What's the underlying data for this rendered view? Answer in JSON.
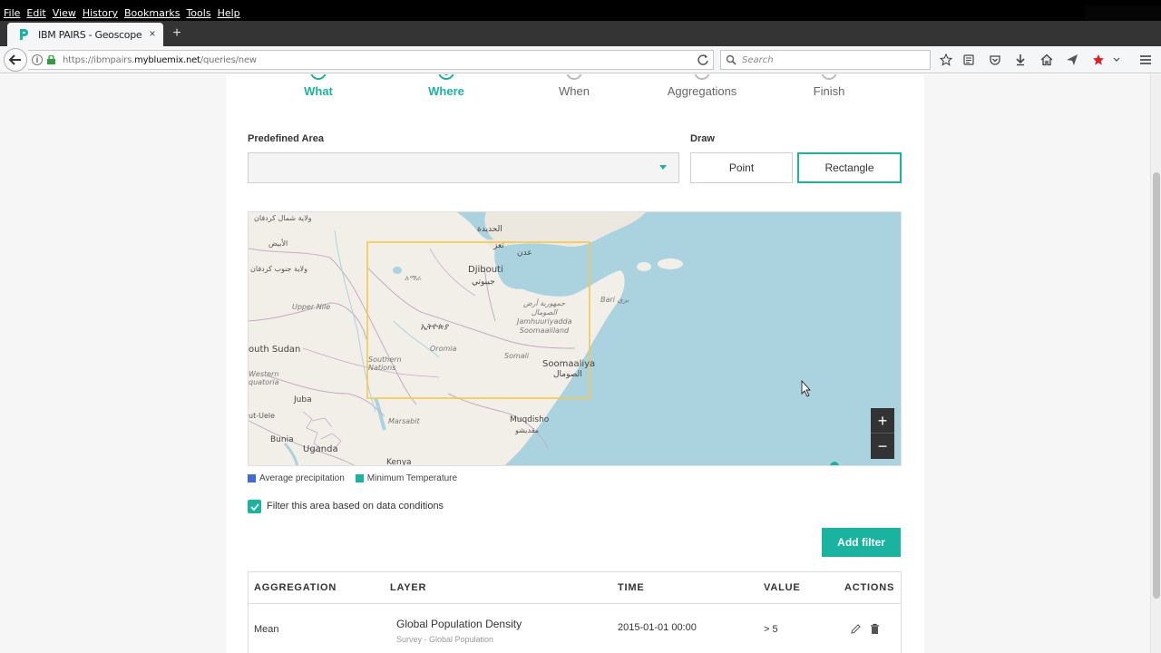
{
  "browser": {
    "menu": [
      "File",
      "Edit",
      "View",
      "History",
      "Bookmarks",
      "Tools",
      "Help"
    ],
    "tab_title": "IBM PAIRS - Geoscope - N...",
    "url_prefix": "https://ibmpairs.",
    "url_domain": "mybluemix.net",
    "url_path": "/queries/new",
    "search_placeholder": "Search",
    "accent_color": "#1ab39f"
  },
  "steps": [
    {
      "label": "What",
      "state": "done"
    },
    {
      "label": "Where",
      "state": "current"
    },
    {
      "label": "When",
      "state": "todo"
    },
    {
      "label": "Aggregations",
      "state": "todo"
    },
    {
      "label": "Finish",
      "state": "todo"
    }
  ],
  "area": {
    "predefined_label": "Predefined Area",
    "predefined_value": "",
    "draw_label": "Draw",
    "point_label": "Point",
    "rectangle_label": "Rectangle"
  },
  "map": {
    "labels": {
      "hodeidah": "الحديدة",
      "taiz": "تعز",
      "aden": "عدن",
      "djibouti": "Djibouti",
      "djibouti_ar": "جيبوتي",
      "amhara": "አማራ",
      "ethiopia": "ኢትዮጵያ",
      "oromia": "Oromia",
      "somali": "Somali",
      "somaliland": "Jamhuuriyadda Soomaaliland",
      "somaliland_ar": "جمهورية أرض الصومال",
      "somaliya": "Soomaaliya",
      "somaliya_ar": "الصومال",
      "bari": "Bari",
      "bari_ar": "بري",
      "southern_nations": "Southern Nations",
      "upper_nile": "Upper Nile",
      "south_sudan": "outh Sudan",
      "western_equatoria": "Western quatoria",
      "juba": "Juba",
      "ut_uele": "ut-Uele",
      "bunia": "Bunia",
      "uganda": "Uganda",
      "marsabit": "Marsabit",
      "mogadishu": "Muqdisho",
      "mogadishu_ar": "مقديشو",
      "kenya": "Kenya",
      "kordofan_n": "ولاية شمال كردفان",
      "white_nile": "الأبيض",
      "kordofan_s": "ولاية جنوب كردفان"
    },
    "zoom_in": "+",
    "zoom_out": "−"
  },
  "legend": [
    {
      "label": "Average precipitation",
      "color": "#3f6bd8"
    },
    {
      "label": "Minimum Temperature",
      "color": "#1ab39f"
    }
  ],
  "filter": {
    "checkbox_label": "Filter this area based on data conditions",
    "checked": true,
    "add_filter_label": "Add filter"
  },
  "table": {
    "headers": [
      "AGGREGATION",
      "LAYER",
      "TIME",
      "VALUE",
      "ACTIONS"
    ],
    "rows": [
      {
        "aggregation": "Mean",
        "layer": "Global Population Density",
        "layer_source": "Survey - Global Population",
        "time": "2015-01-01 00:00",
        "value": "> 5"
      }
    ]
  }
}
